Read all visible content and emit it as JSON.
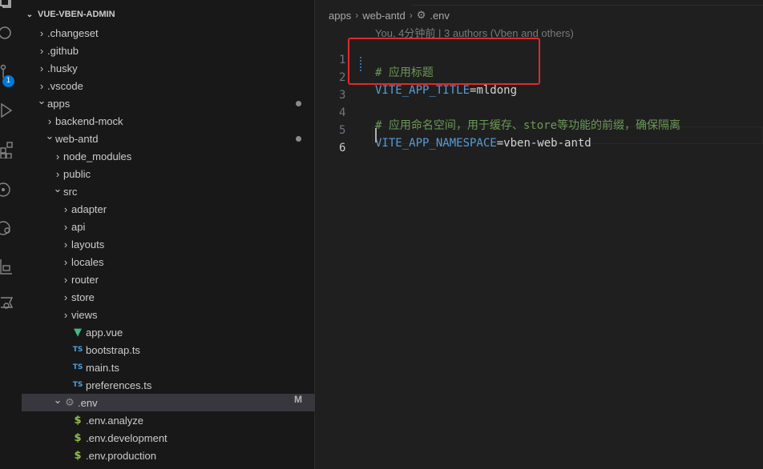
{
  "activity_bar": {
    "icons": [
      "explorer-icon",
      "search-icon",
      "source-control-icon",
      "run-debug-icon",
      "extensions-icon",
      "git-graph-icon",
      "remote-icon",
      "testing-icon",
      "database-icon"
    ],
    "scm_badge": "1"
  },
  "explorer": {
    "root_title": "VUE-VBEN-ADMIN",
    "rows": [
      {
        "label": ".changeset",
        "type": "folder",
        "expanded": false,
        "depth": 1
      },
      {
        "label": ".github",
        "type": "folder",
        "expanded": false,
        "depth": 1
      },
      {
        "label": ".husky",
        "type": "folder",
        "expanded": false,
        "depth": 1
      },
      {
        "label": ".vscode",
        "type": "folder",
        "expanded": false,
        "depth": 1
      },
      {
        "label": "apps",
        "type": "folder",
        "expanded": true,
        "depth": 1,
        "modified_dot": true
      },
      {
        "label": "backend-mock",
        "type": "folder",
        "expanded": false,
        "depth": 2
      },
      {
        "label": "web-antd",
        "type": "folder",
        "expanded": true,
        "depth": 2,
        "modified_dot": true
      },
      {
        "label": "node_modules",
        "type": "folder",
        "expanded": false,
        "depth": 3
      },
      {
        "label": "public",
        "type": "folder",
        "expanded": false,
        "depth": 3
      },
      {
        "label": "src",
        "type": "folder",
        "expanded": true,
        "depth": 3
      },
      {
        "label": "adapter",
        "type": "folder",
        "expanded": false,
        "depth": 4
      },
      {
        "label": "api",
        "type": "folder",
        "expanded": false,
        "depth": 4
      },
      {
        "label": "layouts",
        "type": "folder",
        "expanded": false,
        "depth": 4
      },
      {
        "label": "locales",
        "type": "folder",
        "expanded": false,
        "depth": 4
      },
      {
        "label": "router",
        "type": "folder",
        "expanded": false,
        "depth": 4
      },
      {
        "label": "store",
        "type": "folder",
        "expanded": false,
        "depth": 4
      },
      {
        "label": "views",
        "type": "folder",
        "expanded": false,
        "depth": 4
      },
      {
        "label": "app.vue",
        "type": "vue",
        "depth": 4
      },
      {
        "label": "bootstrap.ts",
        "type": "ts",
        "depth": 4
      },
      {
        "label": "main.ts",
        "type": "ts",
        "depth": 4
      },
      {
        "label": "preferences.ts",
        "type": "ts",
        "depth": 4
      },
      {
        "label": ".env",
        "type": "gear-folder",
        "expanded": true,
        "depth": 3,
        "selected": true,
        "badge": "M"
      },
      {
        "label": ".env.analyze",
        "type": "dollar",
        "depth": 4
      },
      {
        "label": ".env.development",
        "type": "dollar",
        "depth": 4
      },
      {
        "label": ".env.production",
        "type": "dollar",
        "depth": 4
      }
    ]
  },
  "editor": {
    "breadcrumb": [
      "apps",
      "web-antd",
      ".env"
    ],
    "blame": "You, 4分钟前 | 3 authors (Vben and others)",
    "lines": [
      {
        "num": "1",
        "comment": "# 应用标题"
      },
      {
        "num": "2",
        "key": "VITE_APP_TITLE",
        "value": "mldong"
      },
      {
        "num": "3"
      },
      {
        "num": "4",
        "comment": "# 应用命名空间，用于缓存、store等功能的前缀，确保隔离"
      },
      {
        "num": "5",
        "key": "VITE_APP_NAMESPACE",
        "value": "vben-web-antd"
      },
      {
        "num": "6",
        "active": true
      }
    ],
    "eq": "="
  },
  "colors": {
    "accent": "#0078d4",
    "highlight_box": "#e02a2a",
    "comment": "#6a9955",
    "env_key": "#569cd6"
  }
}
